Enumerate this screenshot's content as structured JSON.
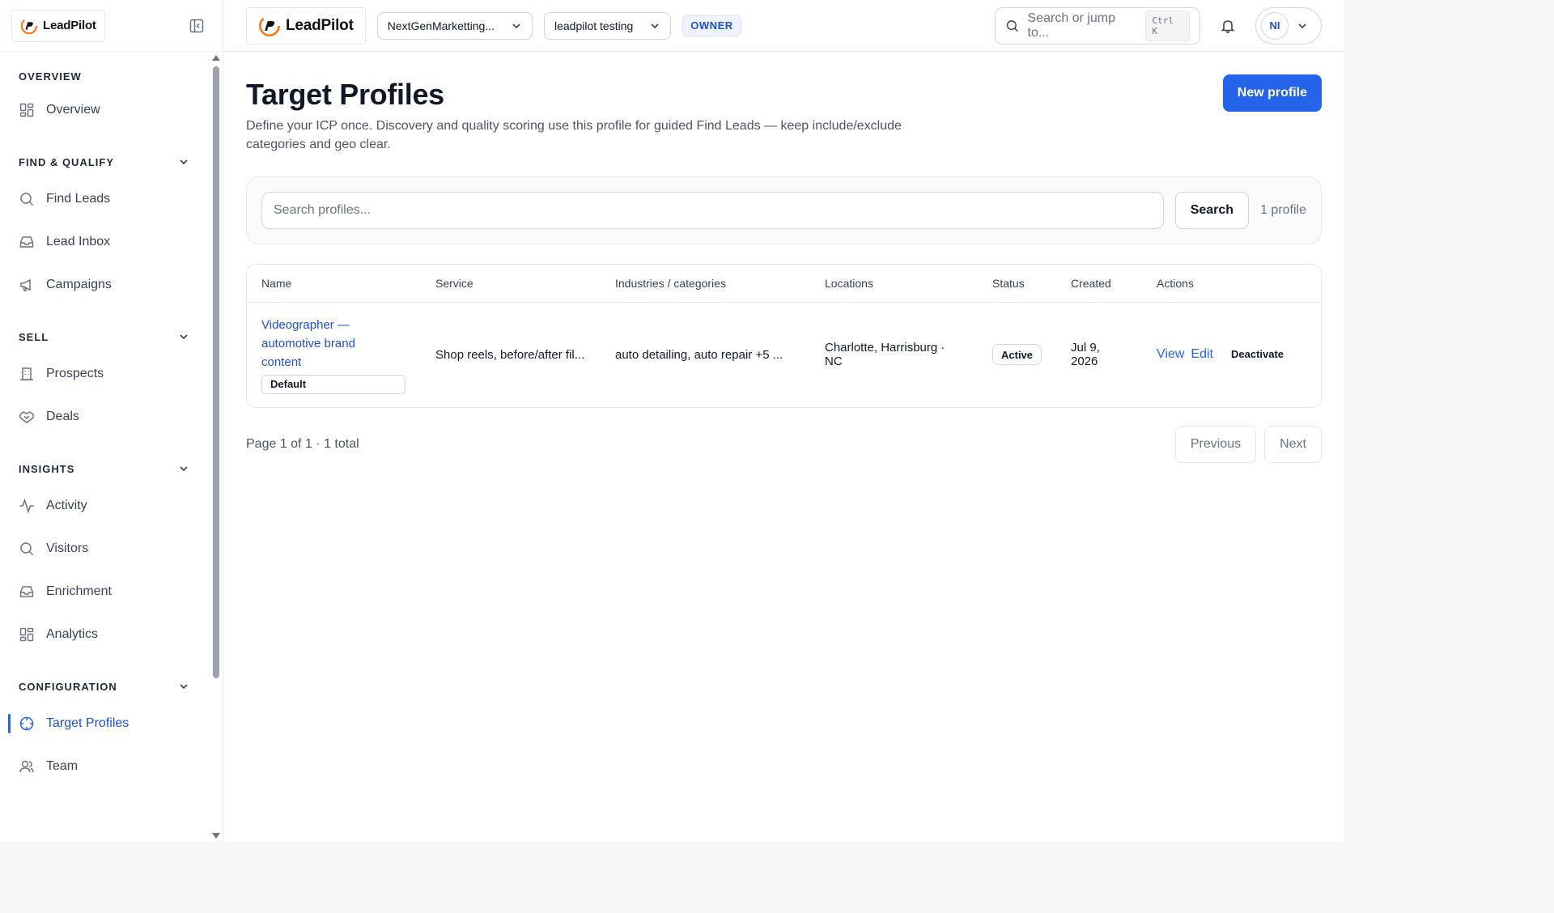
{
  "brand": {
    "name": "LeadPilot"
  },
  "sidebar": {
    "sections": [
      {
        "title": "OVERVIEW",
        "collapsible": false,
        "items": [
          {
            "label": "Overview",
            "icon": "grid-icon"
          }
        ]
      },
      {
        "title": "FIND & QUALIFY",
        "collapsible": true,
        "items": [
          {
            "label": "Find Leads",
            "icon": "search-icon"
          },
          {
            "label": "Lead Inbox",
            "icon": "inbox-icon"
          },
          {
            "label": "Campaigns",
            "icon": "megaphone-icon"
          }
        ]
      },
      {
        "title": "SELL",
        "collapsible": true,
        "items": [
          {
            "label": "Prospects",
            "icon": "building-icon"
          },
          {
            "label": "Deals",
            "icon": "handshake-icon"
          }
        ]
      },
      {
        "title": "INSIGHTS",
        "collapsible": true,
        "items": [
          {
            "label": "Activity",
            "icon": "activity-icon"
          },
          {
            "label": "Visitors",
            "icon": "search-icon"
          },
          {
            "label": "Enrichment",
            "icon": "inbox-icon"
          },
          {
            "label": "Analytics",
            "icon": "grid-icon"
          }
        ]
      },
      {
        "title": "CONFIGURATION",
        "collapsible": true,
        "items": [
          {
            "label": "Target Profiles",
            "icon": "crosshair-icon",
            "active": true
          },
          {
            "label": "Team",
            "icon": "users-icon"
          }
        ]
      }
    ]
  },
  "topbar": {
    "workspace": "NextGenMarketting...",
    "project": "leadpilot testing",
    "role": "OWNER",
    "search_placeholder": "Search or jump to...",
    "shortcut": "Ctrl K",
    "user_initials": "NI"
  },
  "page": {
    "title": "Target Profiles",
    "description": "Define your ICP once. Discovery and quality scoring use this profile for guided Find Leads — keep include/exclude categories and geo clear.",
    "new_button": "New profile",
    "search_placeholder": "Search profiles...",
    "search_button": "Search",
    "count": "1 profile"
  },
  "table": {
    "columns": [
      "Name",
      "Service",
      "Industries / categories",
      "Locations",
      "Status",
      "Created",
      "Actions"
    ],
    "rows": [
      {
        "name": "Videographer — automotive brand content",
        "tag": "Default",
        "service": "Shop reels, before/after fil...",
        "industries": "auto detailing, auto repair +5 ...",
        "locations": "Charlotte, Harrisburg · NC",
        "status": "Active",
        "created": "Jul 9, 2026",
        "actions": {
          "view": "View",
          "edit": "Edit",
          "deactivate": "Deactivate"
        }
      }
    ]
  },
  "pagination": {
    "summary": "Page 1 of 1 · 1 total",
    "previous": "Previous",
    "next": "Next"
  },
  "colors": {
    "accent": "#2563eb",
    "link": "#1d4ed8"
  }
}
